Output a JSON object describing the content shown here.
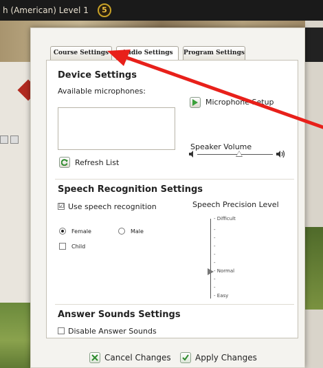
{
  "app": {
    "title": "h (American) Level 1",
    "coin_value": "5"
  },
  "dialog": {
    "tabs": [
      {
        "label": "Course Settings",
        "active": false
      },
      {
        "label": "Audio Settings",
        "active": true
      },
      {
        "label": "Program Settings",
        "active": false
      }
    ],
    "device": {
      "heading": "Device Settings",
      "microphones_label": "Available microphones:",
      "microphones": [],
      "mic_setup_label": "Microphone Setup",
      "refresh_label": "Refresh List",
      "speaker_volume_label": "Speaker Volume",
      "speaker_volume_level": 0.55
    },
    "speech": {
      "heading": "Speech Recognition Settings",
      "use_recognition_label": "Use speech recognition",
      "use_recognition_checked": true,
      "check_mark": "☑",
      "female_label": "Female",
      "male_label": "Male",
      "selected_voice": "Female",
      "child_label": "Child",
      "child_checked": false,
      "precision_label": "Speech Precision Level",
      "precision_difficult": "Difficult",
      "precision_normal": "Normal",
      "precision_easy": "Easy",
      "precision_selected": "Normal"
    },
    "answer": {
      "heading": "Answer Sounds Settings",
      "disable_label": "Disable Answer Sounds",
      "disable_checked": false
    }
  },
  "footer": {
    "cancel_label": "Cancel Changes",
    "apply_label": "Apply Changes"
  },
  "colors": {
    "annotation_arrow": "#e8201a",
    "play_icon": "#3aa03a",
    "cancel_icon": "#2e8b2e",
    "apply_icon": "#2e8b2e"
  }
}
